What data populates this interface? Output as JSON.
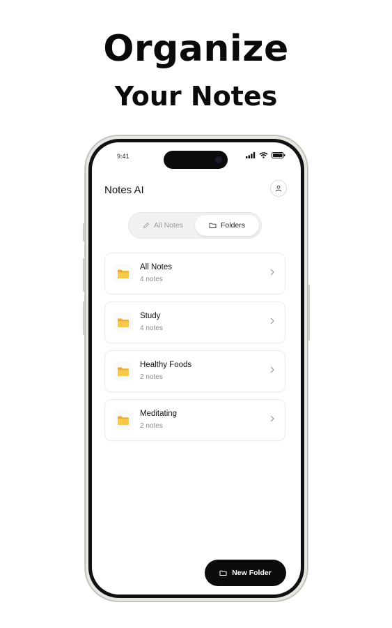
{
  "hero": {
    "line1": "Organize",
    "line2": "Your Notes"
  },
  "status_bar": {
    "time": "9:41",
    "icons": [
      "signal-icon",
      "wifi-icon",
      "battery-icon"
    ]
  },
  "header": {
    "title": "Notes AI",
    "profile_icon": "person-icon"
  },
  "segmented_control": {
    "options": [
      {
        "label": "All Notes",
        "icon": "pencil-icon",
        "selected": false
      },
      {
        "label": "Folders",
        "icon": "folder-outline-icon",
        "selected": true
      }
    ]
  },
  "folders": [
    {
      "name": "All Notes",
      "count": "4 notes",
      "icon": "folder-icon"
    },
    {
      "name": "Study",
      "count": "4 notes",
      "icon": "folder-icon"
    },
    {
      "name": "Healthy Foods",
      "count": "2 notes",
      "icon": "folder-icon"
    },
    {
      "name": "Meditating",
      "count": "2 notes",
      "icon": "folder-icon"
    }
  ],
  "fab": {
    "label": "New Folder",
    "icon": "folder-outline-icon"
  },
  "colors": {
    "background": "#ffffff",
    "text_primary": "#111111",
    "text_secondary": "#8d8d8d",
    "button_dark": "#0c0c0c",
    "folder_yellow": "#f4c542"
  }
}
